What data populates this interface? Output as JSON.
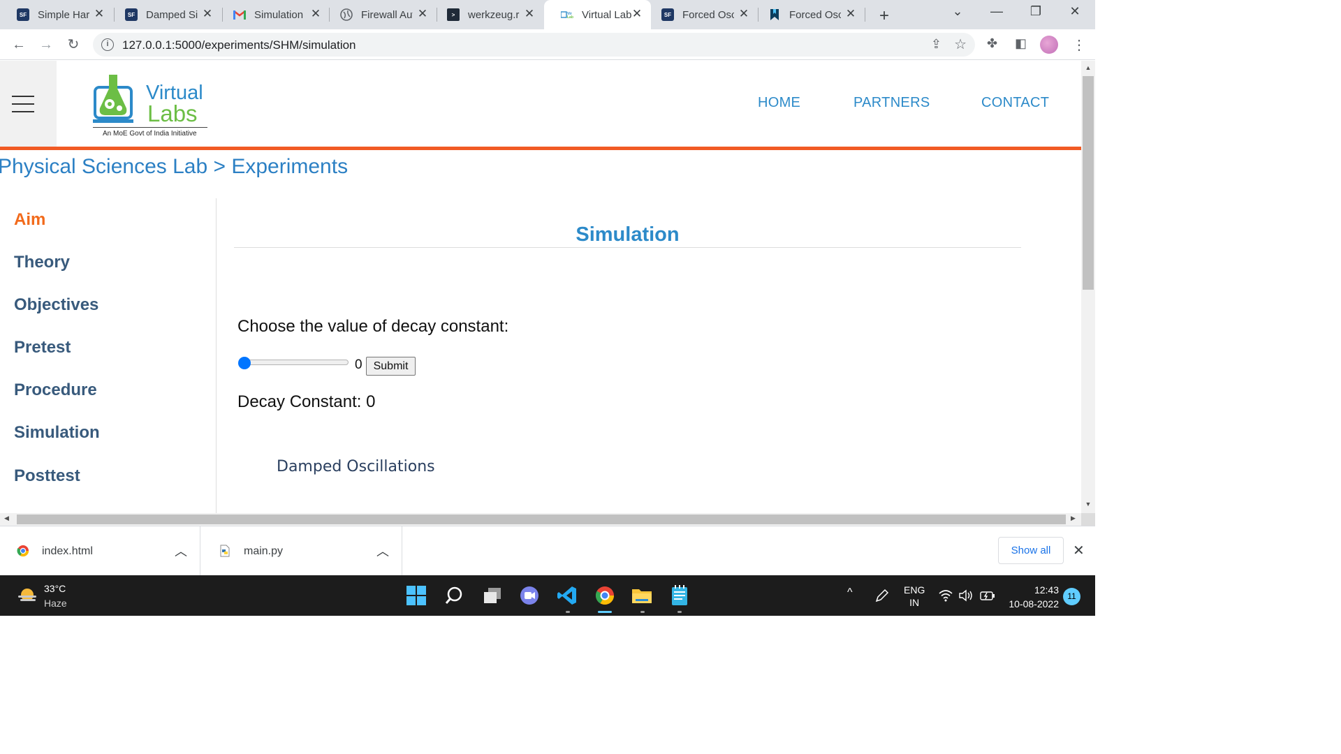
{
  "browser": {
    "tabs": [
      {
        "title": "Simple Harmonic Motion",
        "favicon": "sf-favicon",
        "active": false
      },
      {
        "title": "Damped Simple Harmonic",
        "favicon": "sf-favicon",
        "active": false
      },
      {
        "title": "Simulation",
        "favicon": "gmail-icon",
        "active": false
      },
      {
        "title": "Firewall Authentication",
        "favicon": "globe-icon",
        "active": false
      },
      {
        "title": "werkzeug.routing",
        "favicon": "terminal-icon",
        "active": false
      },
      {
        "title": "Virtual Labs",
        "favicon": "virtual-labs-favicon",
        "active": true
      },
      {
        "title": "Forced Oscillations",
        "favicon": "sf-favicon",
        "active": false
      },
      {
        "title": "Forced Oscillations",
        "favicon": "bookmark-favicon",
        "active": false
      }
    ],
    "url": "127.0.0.1:5000/experiments/SHM/simulation",
    "icons": {
      "new_tab": "+",
      "tab_close": "✕",
      "back": "←",
      "forward": "→",
      "reload": "↻",
      "tab_search": "⌄",
      "minimize": "—",
      "restore": "❐",
      "close": "✕",
      "share": "⇪",
      "star": "☆",
      "extensions": "✤",
      "sidepanel": "◧",
      "menu": "⋮",
      "info": "i"
    }
  },
  "site": {
    "logo": {
      "line1": "Virtual",
      "line2": "Labs",
      "tagline": "An MoE Govt of India Initiative"
    },
    "nav": [
      "HOME",
      "PARTNERS",
      "CONTACT"
    ],
    "breadcrumb": "Physical Sciences Lab > Experiments",
    "sidebar": [
      {
        "label": "Aim",
        "active": true
      },
      {
        "label": "Theory",
        "active": false
      },
      {
        "label": "Objectives",
        "active": false
      },
      {
        "label": "Pretest",
        "active": false
      },
      {
        "label": "Procedure",
        "active": false
      },
      {
        "label": "Simulation",
        "active": false
      },
      {
        "label": "Posttest",
        "active": false
      }
    ],
    "content": {
      "title": "Simulation",
      "choose_label": "Choose the value of decay constant:",
      "slider_value": "0",
      "submit_label": "Submit",
      "decay_output": "Decay Constant: 0",
      "plot_title": "Damped Oscillations"
    },
    "colors": {
      "accent": "#2c8ac9",
      "active_nav": "#f26a1b",
      "bar": "#f15a24",
      "sidebar_text": "#385a7c"
    }
  },
  "downloads": {
    "items": [
      {
        "name": "index.html",
        "icon": "chrome-file-icon"
      },
      {
        "name": "main.py",
        "icon": "python-file-icon"
      }
    ],
    "show_all": "Show all",
    "close": "✕"
  },
  "taskbar": {
    "weather": {
      "temp": "33°C",
      "desc": "Haze"
    },
    "apps": [
      "start-icon",
      "search-icon",
      "task-view-icon",
      "teams-chat-icon",
      "vscode-icon",
      "chrome-icon",
      "file-explorer-icon",
      "notepad-icon"
    ],
    "tray": {
      "lang1": "ENG",
      "lang2": "IN",
      "chevron": "^"
    },
    "clock": {
      "time": "12:43",
      "date": "10-08-2022"
    },
    "notifications": "11"
  }
}
